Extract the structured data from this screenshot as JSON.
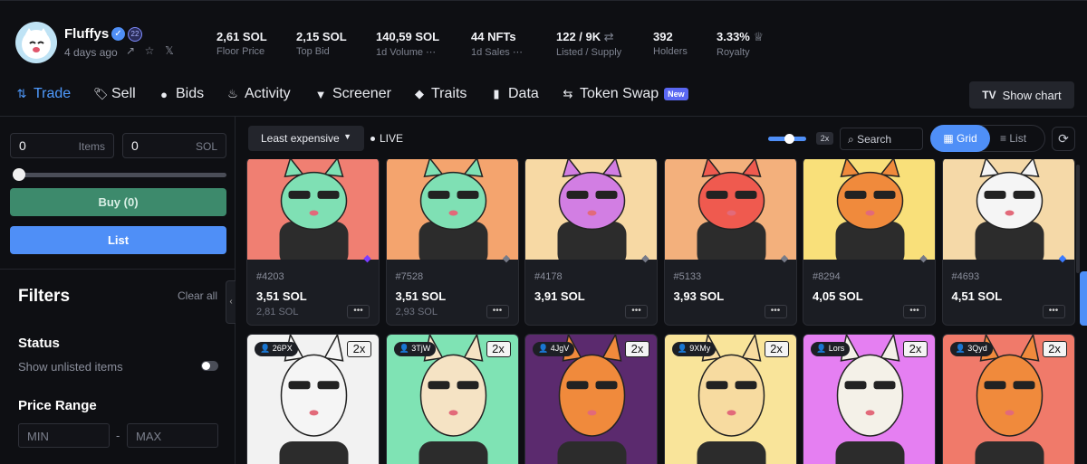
{
  "collection": {
    "name": "Fluffys",
    "badge": "22",
    "age": "4 days ago"
  },
  "stats": [
    {
      "value": "2,61 SOL",
      "label": "Floor Price"
    },
    {
      "value": "2,15 SOL",
      "label": "Top Bid"
    },
    {
      "value": "140,59 SOL",
      "label": "1d Volume"
    },
    {
      "value": "44 NFTs",
      "label": "1d Sales"
    },
    {
      "value": "122 / 9K",
      "label": "Listed / Supply"
    },
    {
      "value": "392",
      "label": "Holders"
    },
    {
      "value": "3.33%",
      "label": "Royalty"
    }
  ],
  "nav": [
    {
      "label": "Trade",
      "icon": "trade-icon"
    },
    {
      "label": "Sell",
      "icon": "tag-icon"
    },
    {
      "label": "Bids",
      "icon": "coin-icon"
    },
    {
      "label": "Activity",
      "icon": "flame-icon"
    },
    {
      "label": "Screener",
      "icon": "filter-icon"
    },
    {
      "label": "Traits",
      "icon": "gem-icon"
    },
    {
      "label": "Data",
      "icon": "bar-chart-icon"
    },
    {
      "label": "Token Swap",
      "icon": "swap-icon"
    }
  ],
  "new_badge": "New",
  "show_chart": "Show chart",
  "buy_panel": {
    "items_value": "0",
    "items_unit": "Items",
    "sol_value": "0",
    "sol_unit": "SOL",
    "buy_label": "Buy (0)",
    "list_label": "List"
  },
  "filters": {
    "title": "Filters",
    "clear_all": "Clear all",
    "status_title": "Status",
    "status_option": "Show unlisted items",
    "price_title": "Price Range",
    "min_placeholder": "MIN",
    "max_placeholder": "MAX",
    "dash": "-"
  },
  "toolbar": {
    "sort": "Least expensive",
    "live": "LIVE",
    "zoom": "2x",
    "search": "Search",
    "grid": "Grid",
    "list": "List"
  },
  "cards_row1": [
    {
      "id": "#4203",
      "price": "3,51 SOL",
      "last": "2,81 SOL",
      "bg": "#f07f72",
      "body": "#7fe0b4",
      "gem": "#7b3cff"
    },
    {
      "id": "#7528",
      "price": "3,51 SOL",
      "last": "2,93 SOL",
      "bg": "#f4a46e",
      "body": "#7fe0b4",
      "gem": "#777b88"
    },
    {
      "id": "#4178",
      "price": "3,91 SOL",
      "last": "",
      "bg": "#f7d9a4",
      "body": "#d27ee3",
      "gem": "#777b88"
    },
    {
      "id": "#5133",
      "price": "3,93 SOL",
      "last": "",
      "bg": "#f3b07c",
      "body": "#ef5a4f",
      "gem": "#777b88"
    },
    {
      "id": "#8294",
      "price": "4,05 SOL",
      "last": "",
      "bg": "#f9e07a",
      "body": "#f08a3c",
      "gem": "#777b88"
    },
    {
      "id": "#4693",
      "price": "4,51 SOL",
      "last": "",
      "bg": "#f5d9a8",
      "body": "#f5f5f5",
      "gem": "#3b7bff"
    }
  ],
  "cards_row2": [
    {
      "owner": "26PX",
      "mult": "2x",
      "bg": "#f2f2f2",
      "body": "#f5f5f5"
    },
    {
      "owner": "3TjW",
      "mult": "2x",
      "bg": "#7fe3b4",
      "body": "#f5e3c4"
    },
    {
      "owner": "4JgV",
      "mult": "2x",
      "bg": "#5b2a6e",
      "body": "#f08a3c"
    },
    {
      "owner": "9XMy",
      "mult": "2x",
      "bg": "#f9e49a",
      "body": "#f7dba0"
    },
    {
      "owner": "Lors",
      "mult": "2x",
      "bg": "#e57ff2",
      "body": "#f4f1e8"
    },
    {
      "owner": "3Qyd",
      "mult": "2x",
      "bg": "#f07a6a",
      "body": "#f08a3c"
    }
  ]
}
